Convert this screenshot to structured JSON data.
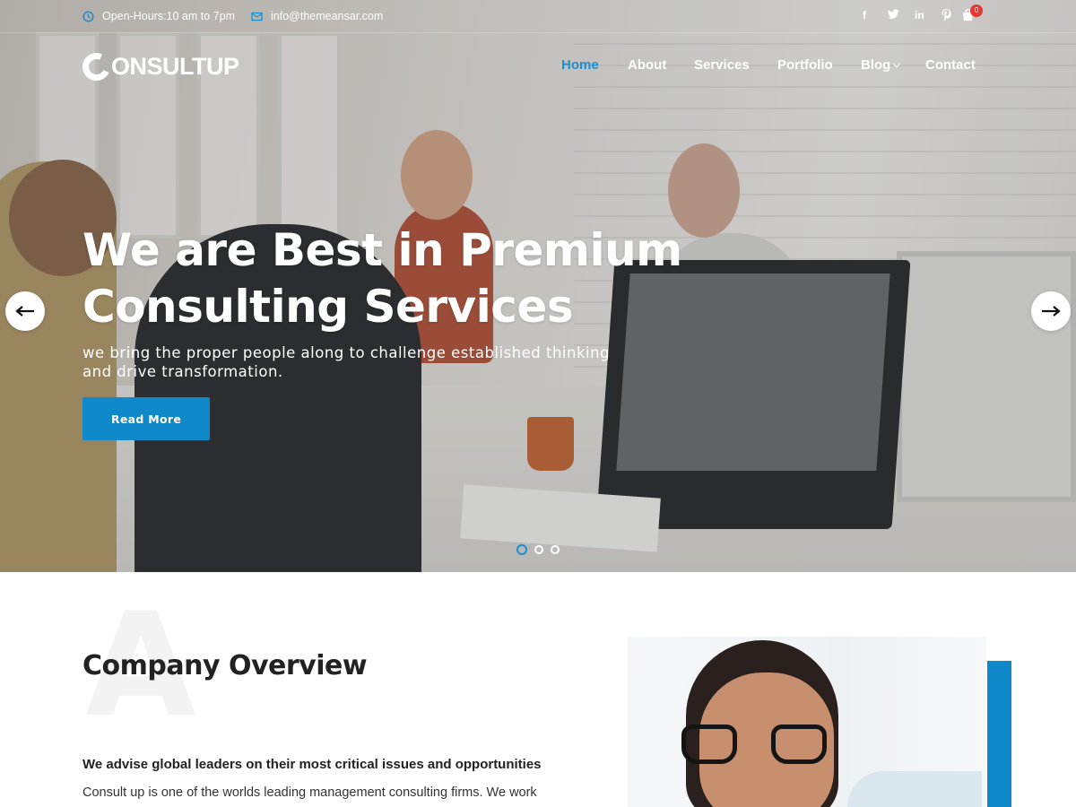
{
  "topbar": {
    "hours": "Open-Hours:10 am to 7pm",
    "email": "info@themeansar.com",
    "social": [
      "f",
      "t",
      "in",
      "p"
    ],
    "cart_count": "0"
  },
  "header": {
    "logo": "ONSULTUP",
    "nav": {
      "home": "Home",
      "about": "About",
      "services": "Services",
      "portfolio": "Portfolio",
      "blog": "Blog",
      "contact": "Contact"
    }
  },
  "hero": {
    "title_line1": "We are Best in Premium",
    "title_line2": "Consulting Services",
    "subtitle_line1": "we bring the proper people along to challenge established thinking",
    "subtitle_line2": "and drive transformation.",
    "button": "Read More"
  },
  "overview": {
    "big_letter": "A",
    "title": "Company Overview",
    "lead": "We advise global leaders on their most critical issues and opportunities",
    "text": "Consult up is one of the worlds leading management consulting firms. We work"
  },
  "colors": {
    "accent": "#0f89c9",
    "badge": "#e53935"
  }
}
